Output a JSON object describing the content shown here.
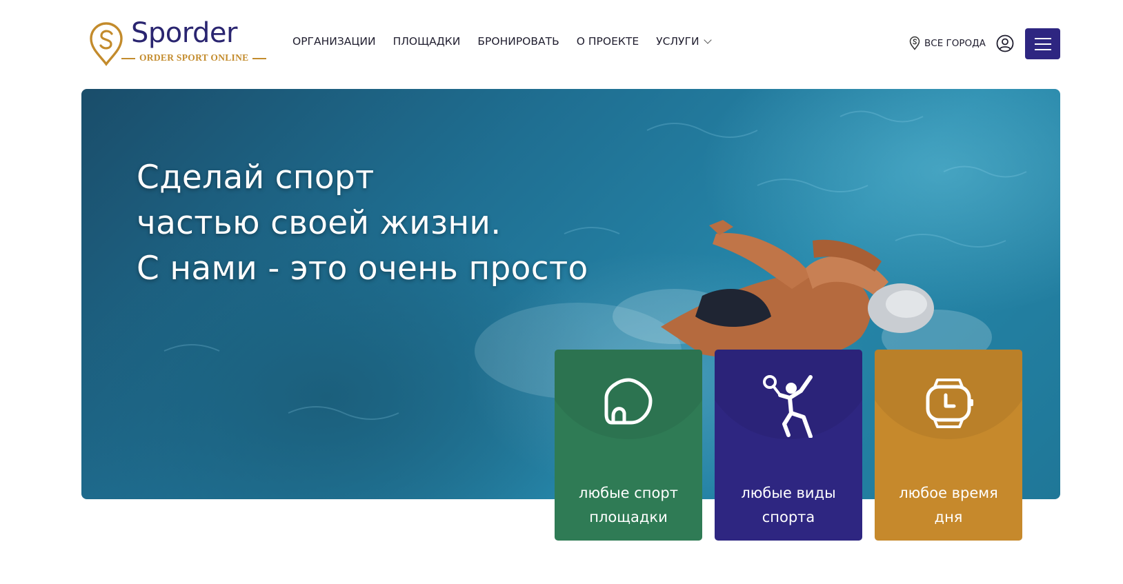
{
  "logo": {
    "name": "Sporder",
    "tagline": "ORDER SPORT ONLINE"
  },
  "nav": {
    "items": [
      "ОРГАНИЗАЦИИ",
      "ПЛОЩАДКИ",
      "БРОНИРОВАТЬ",
      "О ПРОЕКТЕ",
      "УСЛУГИ"
    ]
  },
  "header": {
    "city_label": "ВСЕ ГОРОДА"
  },
  "icons": [
    "map-pin-icon",
    "user-icon",
    "hamburger-menu-icon",
    "chevron-down-icon",
    "stadium-icon",
    "tennis-player-icon",
    "watch-clock-icon"
  ],
  "hero": {
    "title_lines": [
      "Сделай спорт",
      "частью своей жизни.",
      "С нами - это очень просто"
    ]
  },
  "cards": [
    {
      "line1": "любые спорт",
      "line2": "площадки",
      "icon": "stadium-icon",
      "color": "#2f7b55"
    },
    {
      "line1": "любые виды",
      "line2": "спорта",
      "icon": "tennis-player-icon",
      "color": "#2e2681"
    },
    {
      "line1": "любое время",
      "line2": "дня",
      "icon": "watch-clock-icon",
      "color": "#c6892c"
    }
  ],
  "colors": {
    "brand": "#2a2570",
    "accent": "#c38b2c",
    "menu_button": "#2e2681"
  }
}
